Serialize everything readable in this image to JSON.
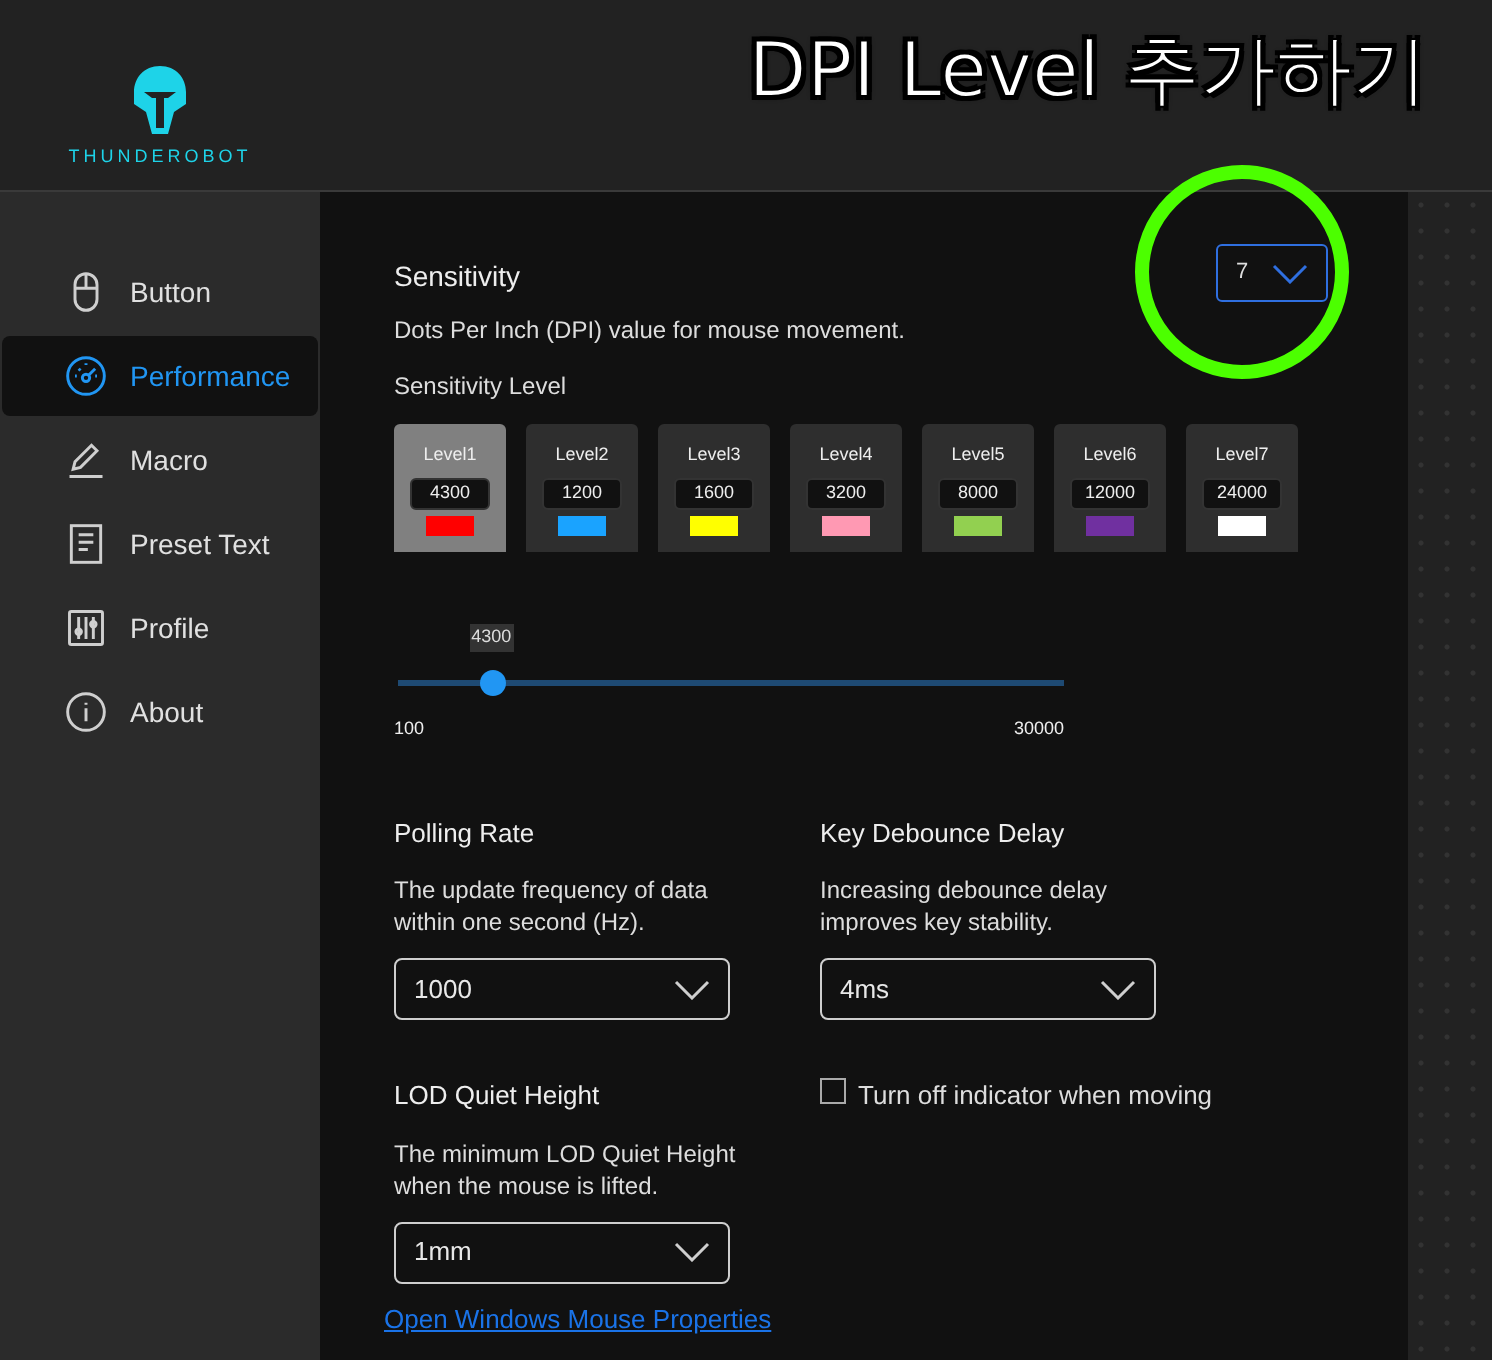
{
  "brand": {
    "name": "THUNDEROBOT"
  },
  "annotation": {
    "text": "DPI Level 추가하기"
  },
  "sidebar": {
    "items": [
      {
        "label": "Button",
        "kind": "mouse",
        "selected": false
      },
      {
        "label": "Performance",
        "kind": "gauge",
        "selected": true
      },
      {
        "label": "Macro",
        "kind": "pen",
        "selected": false
      },
      {
        "label": "Preset Text",
        "kind": "document",
        "selected": false
      },
      {
        "label": "Profile",
        "kind": "sliders",
        "selected": false
      },
      {
        "label": "About",
        "kind": "info",
        "selected": false
      }
    ]
  },
  "sensitivity": {
    "title": "Sensitivity",
    "level_count": "7",
    "description": "Dots Per Inch (DPI) value for mouse movement.",
    "levels_label": "Sensitivity Level",
    "levels": [
      {
        "label": "Level1",
        "value": "4300",
        "color": "#ff0000",
        "selected": true
      },
      {
        "label": "Level2",
        "value": "1200",
        "color": "#1aa3ff",
        "selected": false
      },
      {
        "label": "Level3",
        "value": "1600",
        "color": "#ffff00",
        "selected": false
      },
      {
        "label": "Level4",
        "value": "3200",
        "color": "#ff99b3",
        "selected": false
      },
      {
        "label": "Level5",
        "value": "8000",
        "color": "#92d050",
        "selected": false
      },
      {
        "label": "Level6",
        "value": "12000",
        "color": "#7030a0",
        "selected": false
      },
      {
        "label": "Level7",
        "value": "24000",
        "color": "#ffffff",
        "selected": false
      }
    ],
    "slider": {
      "reading": "4300",
      "level": 0.14,
      "min": "100",
      "max": "30000"
    }
  },
  "polling_rate": {
    "title": "Polling Rate",
    "description": "The update frequency of data within one second (Hz).",
    "value": "1000"
  },
  "key_debounce": {
    "title": "Key Debounce Delay",
    "description": "Increasing debounce delay improves key stability.",
    "value": "4ms"
  },
  "lod": {
    "title": "LOD Quiet Height",
    "description": "The minimum LOD Quiet Height when the mouse is lifted.",
    "value": "1mm"
  },
  "indicator_option": {
    "label": "Turn off indicator when moving",
    "checked": false
  },
  "link": {
    "text": "Open Windows Mouse Properties"
  }
}
